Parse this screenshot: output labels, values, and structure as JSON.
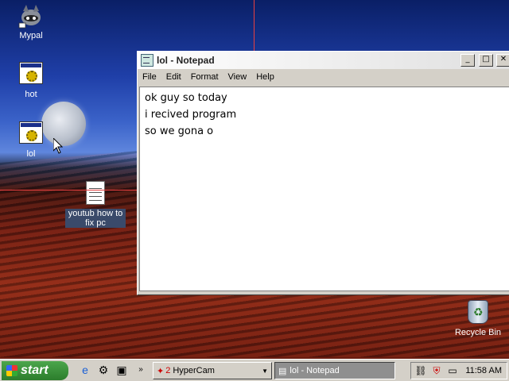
{
  "desktop": {
    "icons": [
      {
        "label": "Mypal",
        "icon": "mypal-raccoon-icon"
      },
      {
        "label": "hot",
        "icon": "executable-icon"
      },
      {
        "label": "lol",
        "icon": "executable-icon"
      },
      {
        "label": "youtub how to fix pc",
        "icon": "text-file-icon"
      },
      {
        "label": "Recycle Bin",
        "icon": "recycle-bin-icon"
      }
    ],
    "capture_rect_color": "#e84040"
  },
  "notepad": {
    "title": "lol - Notepad",
    "menu": [
      "File",
      "Edit",
      "Format",
      "View",
      "Help"
    ],
    "lines": [
      "ok guy so today",
      "i recived program",
      "so we gona o"
    ],
    "title_bg": "#ffffff"
  },
  "taskbar": {
    "start_label": "start",
    "quick_launch": [
      "ie-icon",
      "tool-icon",
      "window-icon"
    ],
    "tasks": [
      {
        "label": "HyperCam",
        "count": "2"
      },
      {
        "label": "lol - Notepad"
      }
    ],
    "tray_icons": [
      "network-icon",
      "shield-icon",
      "monitor-icon"
    ],
    "clock": "11:58 AM",
    "start_color": "#3c963c"
  }
}
